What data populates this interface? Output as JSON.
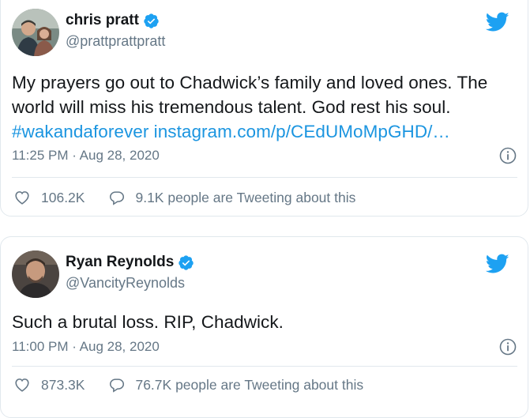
{
  "tweets": [
    {
      "display_name": "chris pratt",
      "handle": "@prattprattpratt",
      "text_plain": "My prayers go out to Chadwick’s family and loved ones. The world will miss his tremendous talent. God rest his soul.",
      "hashtag": "#wakandaforever",
      "link": "instagram.com/p/CEdUMoMpGHD/…",
      "timestamp": "11:25 PM · Aug 28, 2020",
      "likes": "106.2K",
      "conversation": "9.1K people are Tweeting about this"
    },
    {
      "display_name": "Ryan Reynolds",
      "handle": "@VancityReynolds",
      "text_plain": "Such a brutal loss. RIP, Chadwick.",
      "timestamp": "11:00 PM · Aug 28, 2020",
      "likes": "873.3K",
      "conversation": "76.7K people are Tweeting about this"
    }
  ],
  "colors": {
    "twitter_blue": "#1da1f2",
    "link_blue": "#1b95e0",
    "text_dark": "#14171a",
    "text_muted": "#657786",
    "border": "#e1e8ed"
  },
  "icons": {
    "brand": "twitter-bird-icon",
    "verified": "verified-badge-icon",
    "info": "info-icon",
    "like": "heart-icon",
    "reply": "speech-bubble-icon"
  }
}
